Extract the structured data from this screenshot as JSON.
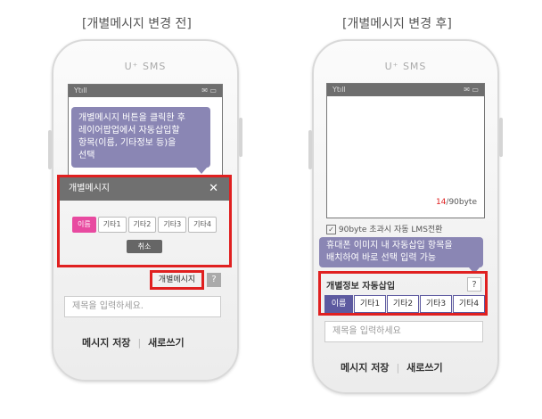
{
  "before": {
    "caption": "[개별메시지 변경 전]",
    "brand": "U⁺ SMS",
    "status_signal": "Ytıll",
    "status_icons": "✉ ▭",
    "tooltip": [
      "개별메시지 버튼을 클릭한 후",
      "레이어팝업에서 자동삽입할",
      "항목(이름, 기타정보 등)을",
      "선택"
    ],
    "popup": {
      "title": "개별메시지",
      "close_icon": "✕",
      "chips": [
        "이름",
        "기타1",
        "기타2",
        "기타3",
        "기타4"
      ],
      "cancel_label": "취소"
    },
    "personal_msg_button": "개별메시지",
    "help": "?",
    "subject_placeholder": "제목을 입력하세요.",
    "save_label": "메시지 저장",
    "new_label": "새로쓰기"
  },
  "after": {
    "caption": "[개별메시지 변경 후]",
    "brand": "U⁺ SMS",
    "status_signal": "Ytıll",
    "status_icons": "✉ ▭",
    "byte_count": "14",
    "byte_total": "/90byte",
    "lms_notice": "90byte 초과시 자동 LMS전환",
    "tooltip": [
      "휴대폰 이미지 내 자동삽입 항목을",
      "배치하여 바로 선택 입력 가능"
    ],
    "auto_insert_title": "개별정보 자동삽입",
    "help": "?",
    "chips": [
      "이름",
      "기타1",
      "기타2",
      "기타3",
      "기타4"
    ],
    "subject_placeholder": "제목을 입력하세요",
    "save_label": "메시지 저장",
    "new_label": "새로쓰기"
  },
  "colors": {
    "accent_red": "#e02020",
    "chip_pink": "#e84aa0",
    "chip_purple": "#5d5aa0",
    "tooltip": "#8a86b4"
  }
}
